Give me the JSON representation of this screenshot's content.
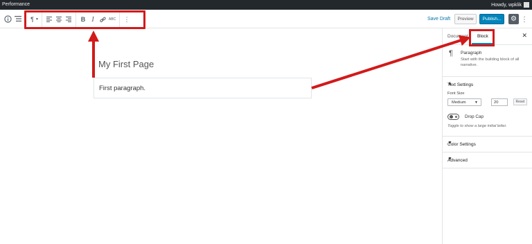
{
  "adminbar": {
    "site": "Performance",
    "greeting": "Howdy, wpklik"
  },
  "block_toolbar": {
    "paragraph_icon": "pilcrow-icon",
    "align_icons": [
      "align-left-icon",
      "align-center-icon",
      "align-right-icon"
    ],
    "bold_label": "B",
    "italic_label": "I",
    "strike_label": "ABC"
  },
  "header": {
    "save_draft": "Save Draft",
    "preview": "Preview",
    "publish": "Publish..."
  },
  "editor": {
    "title": "My First Page",
    "paragraph": "First paragraph."
  },
  "sidebar": {
    "tabs": [
      "Document",
      "Block"
    ],
    "active_tab": "Block",
    "block_card": {
      "title": "Paragraph",
      "description": "Start with the building block of all narrative."
    },
    "text_settings": {
      "title": "Text Settings",
      "font_size_label": "Font Size",
      "font_size_selected": "Medium",
      "font_size_value": "20",
      "reset": "Reset",
      "drop_cap_label": "Drop Cap",
      "drop_cap_help": "Toggle to show a large initial letter."
    },
    "panels": [
      "Color Settings",
      "Advanced"
    ]
  },
  "colors": {
    "highlight": "#d11a1a",
    "accent": "#0085ba",
    "adminbar": "#23282d"
  }
}
